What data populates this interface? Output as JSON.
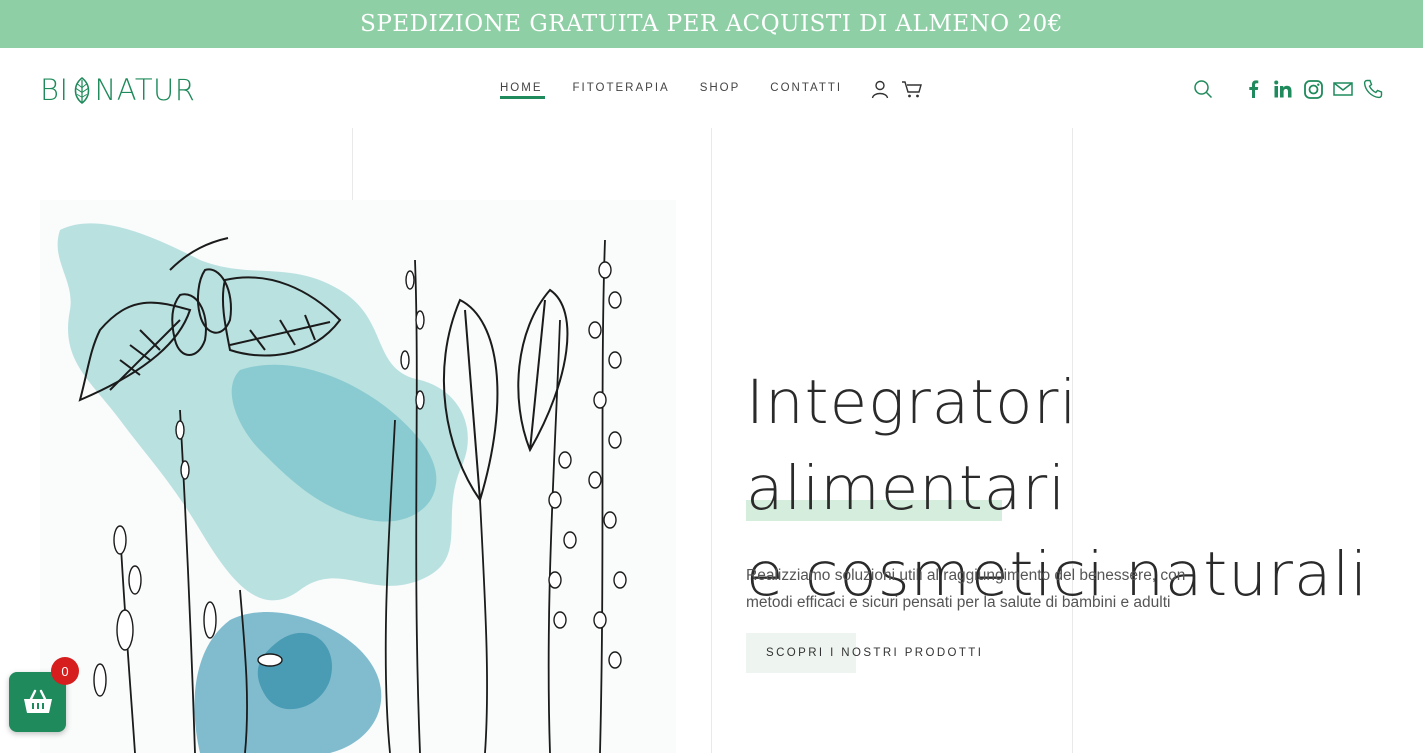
{
  "announcement": {
    "text": "SPEDIZIONE GRATUITA PER ACQUISTI DI ALMENO 20€"
  },
  "brand": {
    "prefix": "BI",
    "suffix": "NATUR",
    "color": "#1f8a5b"
  },
  "nav": {
    "items": [
      {
        "label": "HOME",
        "active": true
      },
      {
        "label": "FITOTERAPIA",
        "active": false
      },
      {
        "label": "SHOP",
        "active": false
      },
      {
        "label": "CONTATTI",
        "active": false
      }
    ]
  },
  "header_icons": {
    "account": "user-icon",
    "cart": "cart-icon",
    "search": "search-icon",
    "social": [
      "facebook-icon",
      "linkedin-icon",
      "instagram-icon",
      "mail-icon",
      "phone-icon"
    ]
  },
  "hero": {
    "headline_line1": "Integratori alimentari",
    "headline_line2": "e cosmetici naturali",
    "description_line1": "Realizziamo soluzioni utili al raggiungimento del benessere, con",
    "description_line2": "metodi efficaci e sicuri pensati per la salute di bambini e adulti",
    "cta_label": "SCOPRI I NOSTRI PRODOTTI",
    "image": "botanical-illustration"
  },
  "cart_widget": {
    "count": "0"
  },
  "colors": {
    "banner": "#8fcfa6",
    "accent": "#1f8a5b",
    "highlight": "#d5eddc",
    "badge": "#d71e1e"
  }
}
